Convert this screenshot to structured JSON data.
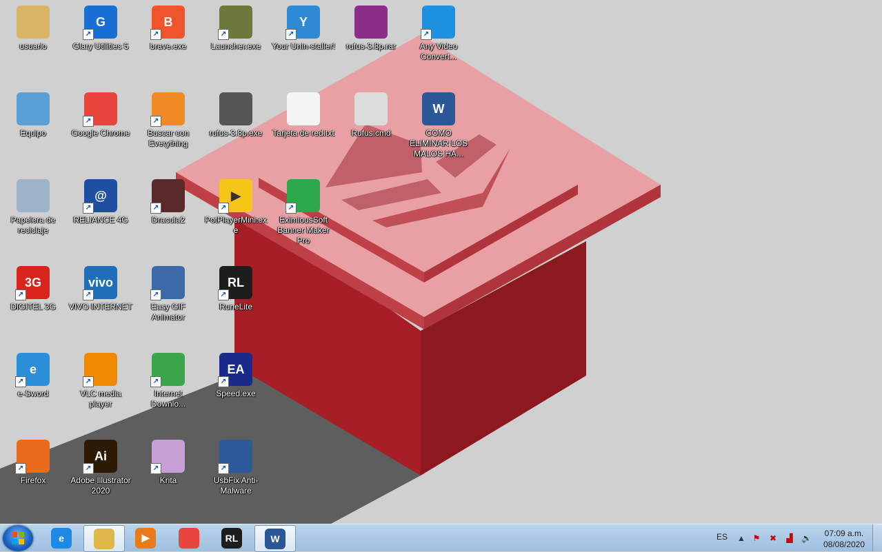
{
  "desktop": {
    "icons": [
      {
        "label": "usuario",
        "name": "usuario-icon",
        "color": "#d8b366",
        "glyph": "",
        "shortcut": false
      },
      {
        "label": "Glary Utilities 5",
        "name": "glary-utilities-icon",
        "color": "#1a6fd6",
        "glyph": "G",
        "shortcut": true
      },
      {
        "label": "brave.exe",
        "name": "brave-icon",
        "color": "#f0542d",
        "glyph": "B",
        "shortcut": true
      },
      {
        "label": "Launcher.exe",
        "name": "launcher-icon",
        "color": "#6b7a3a",
        "glyph": "",
        "shortcut": true
      },
      {
        "label": "Your Unin-staller!",
        "name": "uninstaller-icon",
        "color": "#2d8ad4",
        "glyph": "Y",
        "shortcut": true
      },
      {
        "label": "rufus-3.8p.rar",
        "name": "winrar-archive-icon",
        "color": "#8a2e8a",
        "glyph": "",
        "shortcut": false
      },
      {
        "label": "Any Video Convert...",
        "name": "any-video-converter-icon",
        "color": "#1e90e0",
        "glyph": "",
        "shortcut": true
      },
      {
        "label": "Equipo",
        "name": "computer-icon",
        "color": "#5a9fd6",
        "glyph": "",
        "shortcut": false
      },
      {
        "label": "Google Chrome",
        "name": "chrome-icon",
        "color": "#e8453c",
        "glyph": "",
        "shortcut": true
      },
      {
        "label": "Buscar con Everything",
        "name": "everything-search-icon",
        "color": "#f08a24",
        "glyph": "",
        "shortcut": true
      },
      {
        "label": "rufus-3.8p.exe",
        "name": "rufus-usb-icon",
        "color": "#555555",
        "glyph": "",
        "shortcut": false
      },
      {
        "label": "Tarjeta de red.txt",
        "name": "text-file-icon",
        "color": "#f4f4f4",
        "glyph": "",
        "shortcut": false
      },
      {
        "label": "Rufus.cmd",
        "name": "cmd-file-icon",
        "color": "#dcdcdc",
        "glyph": "",
        "shortcut": false
      },
      {
        "label": "COMO ELIMINAR LOS MALOS HA...",
        "name": "word-document-icon",
        "color": "#2b5797",
        "glyph": "W",
        "shortcut": false
      },
      {
        "label": "Papelera de reciclaje",
        "name": "recycle-bin-icon",
        "color": "#9fb4c8",
        "glyph": "",
        "shortcut": false
      },
      {
        "label": "RELIANCE 4G",
        "name": "reliance-4g-icon",
        "color": "#1e4fa0",
        "glyph": "@",
        "shortcut": true
      },
      {
        "label": "Dracula2",
        "name": "dracula-icon",
        "color": "#5a2a2a",
        "glyph": "",
        "shortcut": true
      },
      {
        "label": "PotPlayerMini.exe",
        "name": "potplayer-icon",
        "color": "#f5c518",
        "glyph": "▶",
        "shortcut": true
      },
      {
        "label": "EximiousSoft Banner Maker Pro",
        "name": "banner-maker-icon",
        "color": "#2aa84a",
        "glyph": "",
        "shortcut": true
      },
      {
        "label": "DIGITEL 3G",
        "name": "digitel-icon",
        "color": "#d8241c",
        "glyph": "3G",
        "shortcut": true
      },
      {
        "label": "VIVO INTERNET",
        "name": "vivo-icon",
        "color": "#1e6fb8",
        "glyph": "vivo",
        "shortcut": true
      },
      {
        "label": "Easy GIF Animator",
        "name": "easy-gif-icon",
        "color": "#3a6aa8",
        "glyph": "",
        "shortcut": true
      },
      {
        "label": "RuneLite",
        "name": "runelite-icon",
        "color": "#1d1d1d",
        "glyph": "RL",
        "shortcut": true
      },
      {
        "label": "e-Sword",
        "name": "esword-icon",
        "color": "#2a8fd8",
        "glyph": "e",
        "shortcut": true
      },
      {
        "label": "VLC media player",
        "name": "vlc-icon",
        "color": "#f08a00",
        "glyph": "",
        "shortcut": true
      },
      {
        "label": "Internet Downlo...",
        "name": "internet-download-manager-icon",
        "color": "#3aa84a",
        "glyph": "",
        "shortcut": true
      },
      {
        "label": "Speed.exe",
        "name": "ea-speed-icon",
        "color": "#1a2a8a",
        "glyph": "EA",
        "shortcut": true
      },
      {
        "label": "Firefox",
        "name": "firefox-icon",
        "color": "#e86a1a",
        "glyph": "",
        "shortcut": true
      },
      {
        "label": "Adobe Illustrator 2020",
        "name": "illustrator-icon",
        "color": "#2d1a05",
        "glyph": "Ai",
        "shortcut": true
      },
      {
        "label": "Krita",
        "name": "krita-icon",
        "color": "#c8a0d8",
        "glyph": "",
        "shortcut": true
      },
      {
        "label": "UsbFix Anti-Malware",
        "name": "usbfix-icon",
        "color": "#2a5a9a",
        "glyph": "",
        "shortcut": true
      }
    ]
  },
  "taskbar": {
    "apps": [
      {
        "name": "taskbar-internet-explorer",
        "color": "#1e88e5",
        "glyph": "e",
        "active": false
      },
      {
        "name": "taskbar-file-explorer",
        "color": "#e0b84a",
        "glyph": "",
        "active": true
      },
      {
        "name": "taskbar-media-player",
        "color": "#e87a1a",
        "glyph": "▶",
        "active": false
      },
      {
        "name": "taskbar-chrome",
        "color": "#e8453c",
        "glyph": "",
        "active": false
      },
      {
        "name": "taskbar-runelite",
        "color": "#1d1d1d",
        "glyph": "RL",
        "active": false
      },
      {
        "name": "taskbar-word",
        "color": "#2b5797",
        "glyph": "W",
        "active": true
      }
    ],
    "language": "ES",
    "clock": {
      "time": "07:09 a.m.",
      "date": "08/08/2020"
    }
  }
}
